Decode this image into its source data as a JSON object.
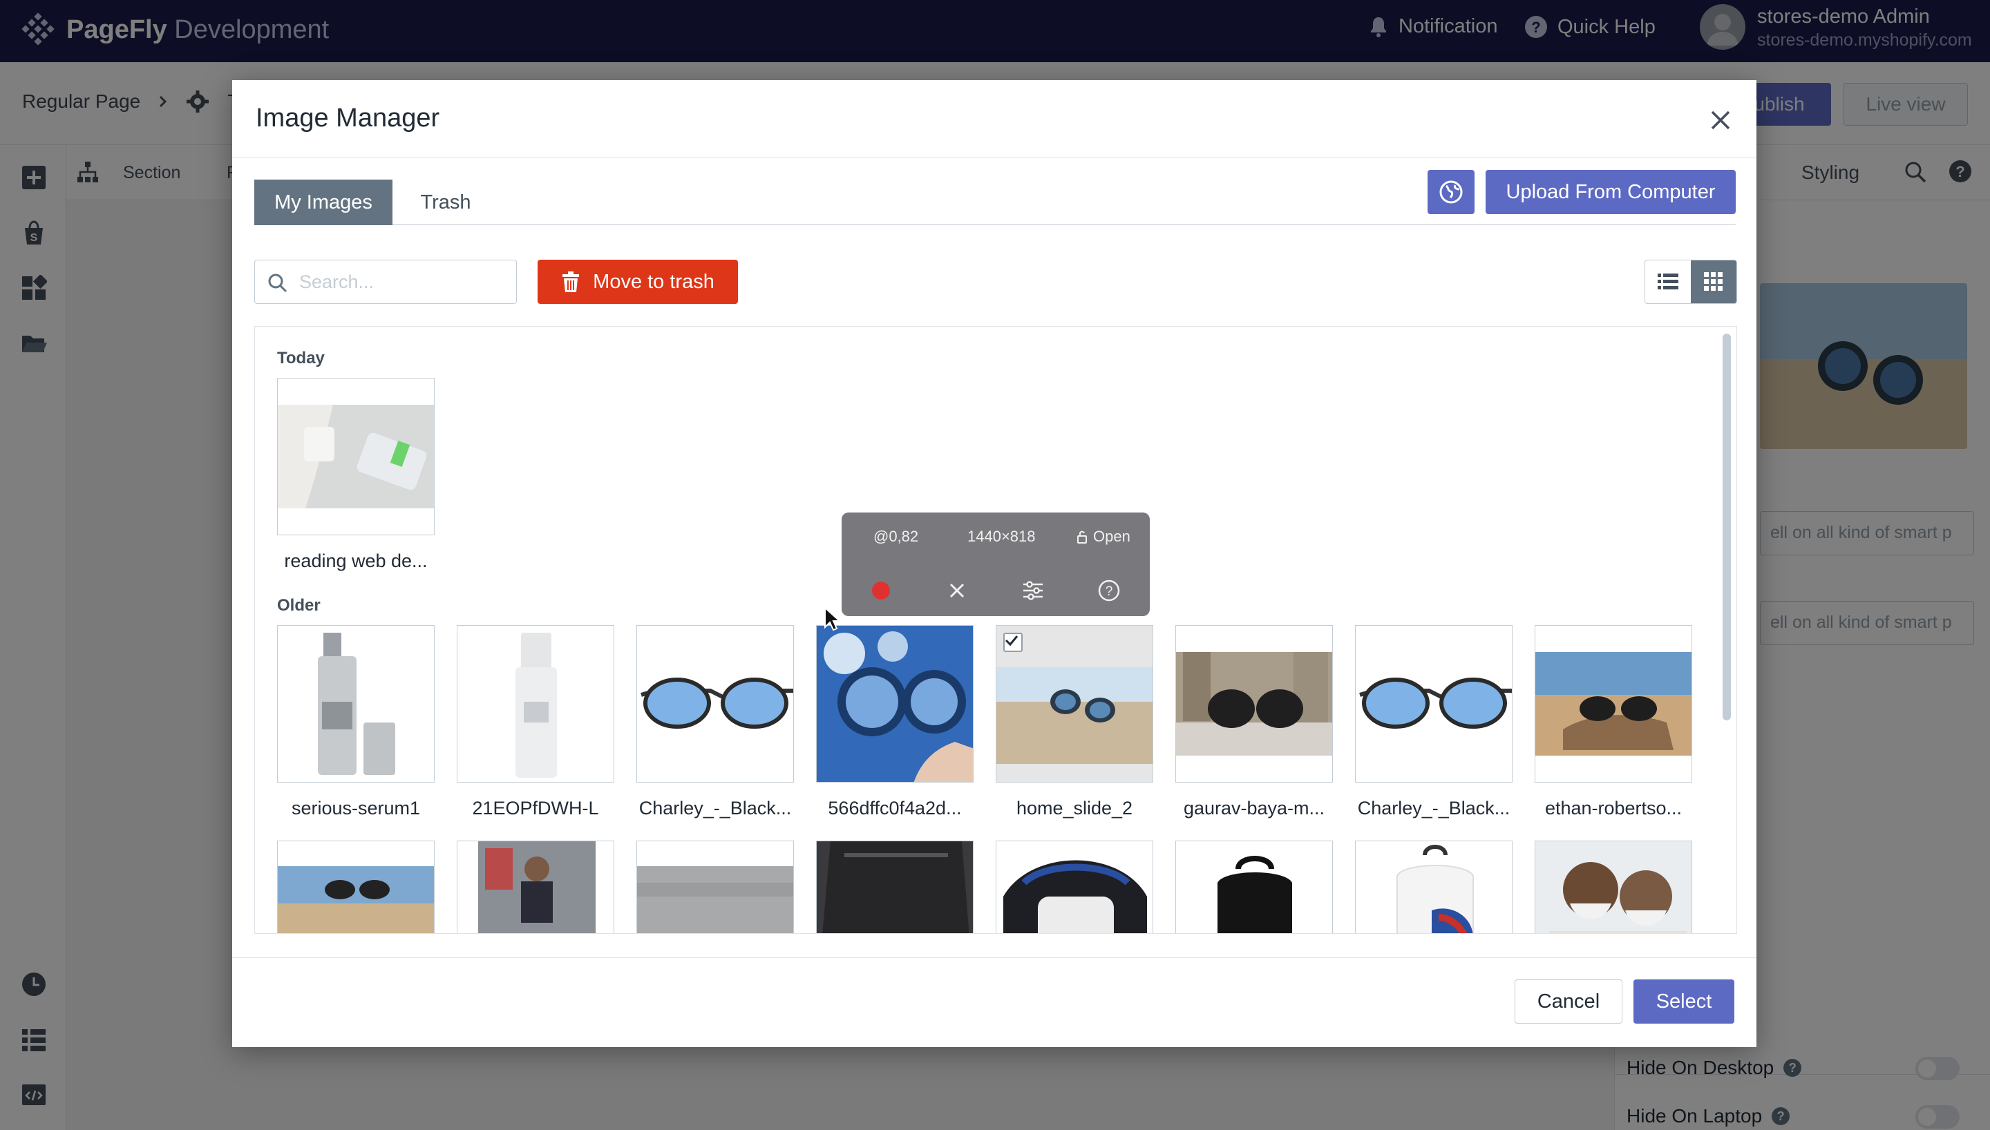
{
  "app": {
    "brand_strong": "PageFly",
    "brand_light": " Development",
    "notification": "Notification",
    "quick_help": "Quick Help",
    "user_name": "stores-demo Admin",
    "user_store": "stores-demo.myshopify.com"
  },
  "subbar": {
    "crumb_page": "Regular Page",
    "crumb_next": "T",
    "publish": "ublish",
    "live_view": "Live view"
  },
  "canvas": {
    "crumb_section": "Section",
    "crumb_next": "F"
  },
  "right_panel": {
    "styling_tab": "Styling",
    "input_1": "ell on all kind of smart p",
    "input_2": "ell on all kind of smart p",
    "hide_desktop": "Hide On Desktop",
    "hide_laptop": "Hide On Laptop"
  },
  "modal": {
    "title": "Image Manager",
    "tabs": [
      {
        "label": "My Images"
      },
      {
        "label": "Trash"
      }
    ],
    "upload_label": "Upload From Computer",
    "search_placeholder": "Search...",
    "move_to_trash": "Move to trash",
    "groups": {
      "today": "Today",
      "older": "Older"
    },
    "today_images": [
      {
        "name": "reading web de...",
        "selected": false
      }
    ],
    "older_images": [
      {
        "name": "serious-serum1",
        "selected": false
      },
      {
        "name": "21EOPfDWH-L",
        "selected": false
      },
      {
        "name": "Charley_-_Black...",
        "selected": false
      },
      {
        "name": "566dffc0f4a2d...",
        "selected": false
      },
      {
        "name": "home_slide_2",
        "selected": true
      },
      {
        "name": "gaurav-baya-m...",
        "selected": false
      },
      {
        "name": "Charley_-_Black...",
        "selected": false
      },
      {
        "name": "ethan-robertso...",
        "selected": false
      }
    ],
    "cancel": "Cancel",
    "select": "Select"
  },
  "recorder": {
    "position": "@0,82",
    "size": "1440×818",
    "lock_label": "Open"
  },
  "colors": {
    "topbar": "#1a1d4d",
    "primary": "#5c6ac4",
    "danger": "#de3618",
    "tab_active": "#637381"
  }
}
